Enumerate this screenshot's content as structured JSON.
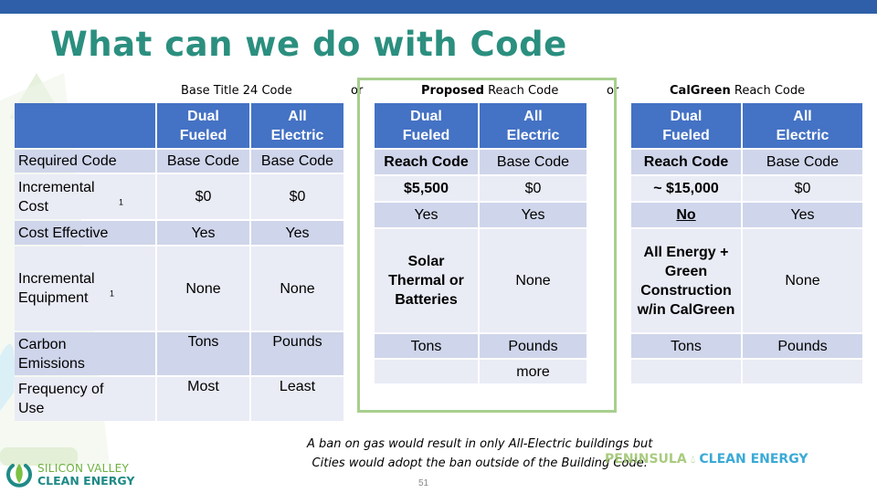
{
  "slide": {
    "title": "What can we do with Code",
    "or_label": "or",
    "page_number": "51",
    "footnote_lines": [
      "A ban on gas would result in only All-Electric buildings but",
      "Cities would adopt the ban outside of the Building Code."
    ],
    "colors": {
      "top_bar": "#2e5fa8",
      "title": "#2b8f7f",
      "table_header": "#4472c4",
      "row_dark": "#cfd5ea",
      "row_light": "#e9ebf5",
      "highlight_box": "#a8cf8e"
    }
  },
  "logos": {
    "svce": {
      "line1": "SILICON VALLEY",
      "line2": "CLEAN ENERGY",
      "icon": "leaf-in-circle-icon"
    },
    "pce": {
      "part1": "PENINSULA",
      "part2": "CLEAN ENERGY",
      "icon": "leaf-drop-icon"
    }
  },
  "row_labels": [
    "Required Code",
    "Incremental Cost",
    "Cost Effective",
    "Incremental Equipment",
    "Carbon Emissions",
    "Frequency of Use"
  ],
  "row_label_superscripts": {
    "Incremental Cost": "1",
    "Incremental Equipment": "1"
  },
  "tables": {
    "base": {
      "caption_bold": "",
      "caption_rest": "Base Title 24 Code",
      "columns": [
        "Dual Fueled",
        "All Electric"
      ],
      "rows": [
        [
          "Base Code",
          "Base Code"
        ],
        [
          "$0",
          "$0"
        ],
        [
          "Yes",
          "Yes"
        ],
        [
          "None",
          "None"
        ],
        [
          "Tons",
          "Pounds"
        ],
        [
          "Most",
          "Least"
        ]
      ]
    },
    "proposed": {
      "caption_bold": "Proposed",
      "caption_rest": " Reach Code",
      "columns": [
        "Dual Fueled",
        "All Electric"
      ],
      "rows": [
        [
          "Reach Code",
          "Base Code"
        ],
        [
          "$5,500",
          "$0"
        ],
        [
          "Yes",
          "Yes"
        ],
        [
          "Solar Thermal or Batteries",
          "None"
        ],
        [
          "Tons",
          "Pounds"
        ],
        [
          "",
          "more"
        ]
      ]
    },
    "calgreen": {
      "caption_bold": "CalGreen",
      "caption_rest": " Reach Code",
      "columns": [
        "Dual Fueled",
        "All Electric"
      ],
      "rows": [
        [
          "Reach Code",
          "Base Code"
        ],
        [
          "~ $15,000",
          "$0"
        ],
        [
          "No",
          "Yes"
        ],
        [
          "All Energy + Green Construction w/in CalGreen",
          "None"
        ],
        [
          "Tons",
          "Pounds"
        ],
        [
          "",
          ""
        ]
      ]
    }
  }
}
